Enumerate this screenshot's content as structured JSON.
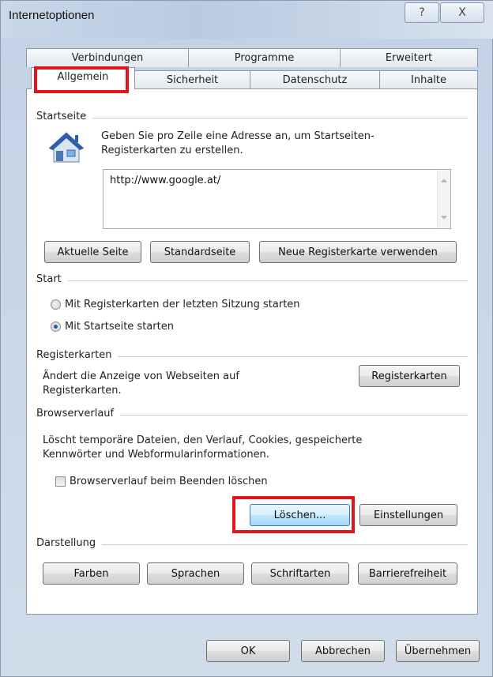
{
  "window": {
    "title": "Internetoptionen",
    "help_glyph": "?",
    "close_glyph": "X"
  },
  "tabs": {
    "top_row": [
      "Verbindungen",
      "Programme",
      "Erweitert"
    ],
    "bottom_row": [
      "Allgemein",
      "Sicherheit",
      "Datenschutz",
      "Inhalte"
    ],
    "active": "Allgemein"
  },
  "startseite": {
    "group_label": "Startseite",
    "description_line1": "Geben Sie pro Zeile eine Adresse an, um Startseiten-",
    "description_line2": "Registerkarten zu erstellen.",
    "url_value": "http://www.google.at/",
    "buttons": {
      "current": "Aktuelle Seite",
      "default": "Standardseite",
      "new_tab": "Neue Registerkarte verwenden"
    }
  },
  "start": {
    "group_label": "Start",
    "option_last_session": "Mit Registerkarten der letzten Sitzung starten",
    "option_home_page": "Mit Startseite starten",
    "selected": "Mit Startseite starten"
  },
  "registerkarten": {
    "group_label": "Registerkarten",
    "description_line1": "Ändert die Anzeige von Webseiten auf",
    "description_line2": "Registerkarten.",
    "button": "Registerkarten"
  },
  "browserverlauf": {
    "group_label": "Browserverlauf",
    "description_line1": "Löscht temporäre Dateien, den Verlauf, Cookies, gespeicherte",
    "description_line2": "Kennwörter und Webformularinformationen.",
    "checkbox_label": "Browserverlauf beim Beenden löschen",
    "checkbox_checked": false,
    "delete_button": "Löschen...",
    "settings_button": "Einstellungen"
  },
  "darstellung": {
    "group_label": "Darstellung",
    "buttons": {
      "colors": "Farben",
      "languages": "Sprachen",
      "fonts": "Schriftarten",
      "accessibility": "Barrierefreiheit"
    }
  },
  "dialog_buttons": {
    "ok": "OK",
    "cancel": "Abbrechen",
    "apply": "Übernehmen"
  },
  "colors": {
    "highlight": "#e2151d",
    "radio_dot": "#1a5fa8"
  }
}
